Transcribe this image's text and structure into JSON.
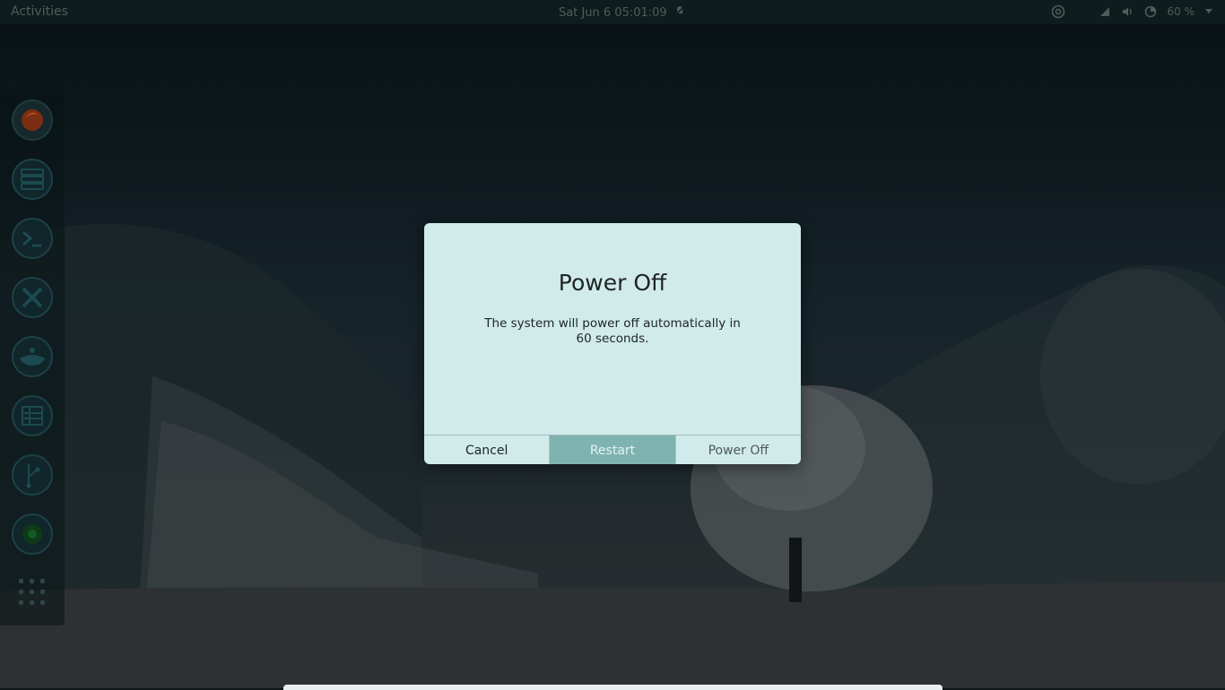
{
  "topbar": {
    "activities": "Activities",
    "clock": "Sat Jun 6  05:01:09",
    "battery_percent": "60 %",
    "icons": [
      "notifications-muted-icon",
      "at-icon",
      "wifi-icon",
      "volume-icon",
      "battery-icon",
      "chevron-down-icon"
    ]
  },
  "dock": {
    "apps": [
      "firefox-icon",
      "files-icon",
      "terminal-icon",
      "tools-icon",
      "package-manager-icon",
      "spreadsheet-icon",
      "git-icon",
      "mixer-icon"
    ],
    "show_apps": "show-apps-icon"
  },
  "dialog": {
    "title": "Power Off",
    "message": "The system will power off automatically in 60 seconds.",
    "buttons": {
      "cancel": "Cancel",
      "restart": "Restart",
      "power_off": "Power Off"
    },
    "active_button": "restart"
  },
  "colors": {
    "dialog_bg": "#d0ebea",
    "active_button": "#7fb3b0",
    "topbar_bg": "#0f1c1d"
  }
}
